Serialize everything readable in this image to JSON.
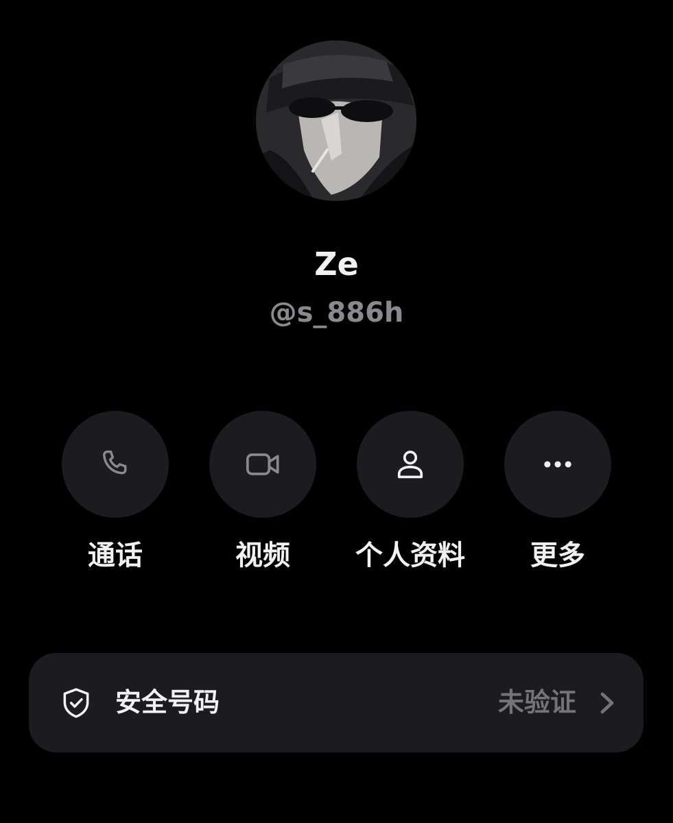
{
  "profile": {
    "display_name": "Ze",
    "username": "@s_886h"
  },
  "actions": [
    {
      "label": "通话",
      "icon": "phone-icon"
    },
    {
      "label": "视频",
      "icon": "video-camera-icon"
    },
    {
      "label": "个人资料",
      "icon": "person-icon"
    },
    {
      "label": "更多",
      "icon": "more-dots-icon"
    }
  ],
  "safety_number": {
    "label": "安全号码",
    "status": "未验证",
    "icon": "shield-check-icon"
  },
  "colors": {
    "background": "#000000",
    "button_background": "#1c1c20",
    "primary_text": "#f2f2f4",
    "secondary_text": "#8a8a8e",
    "icon_gray": "#8a8a8e"
  }
}
